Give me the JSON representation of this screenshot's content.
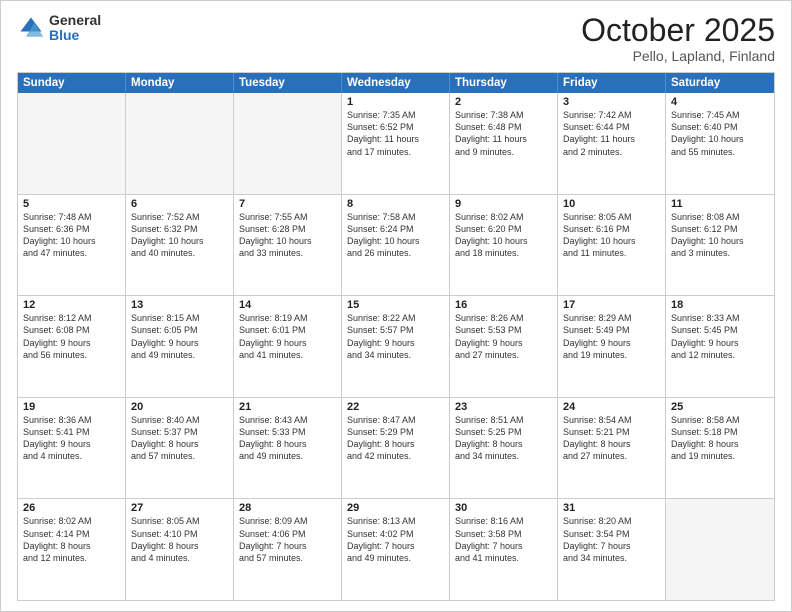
{
  "logo": {
    "general": "General",
    "blue": "Blue"
  },
  "title": {
    "month": "October 2025",
    "location": "Pello, Lapland, Finland"
  },
  "header_days": [
    "Sunday",
    "Monday",
    "Tuesday",
    "Wednesday",
    "Thursday",
    "Friday",
    "Saturday"
  ],
  "weeks": [
    [
      {
        "day": "",
        "text": ""
      },
      {
        "day": "",
        "text": ""
      },
      {
        "day": "",
        "text": ""
      },
      {
        "day": "1",
        "text": "Sunrise: 7:35 AM\nSunset: 6:52 PM\nDaylight: 11 hours\nand 17 minutes."
      },
      {
        "day": "2",
        "text": "Sunrise: 7:38 AM\nSunset: 6:48 PM\nDaylight: 11 hours\nand 9 minutes."
      },
      {
        "day": "3",
        "text": "Sunrise: 7:42 AM\nSunset: 6:44 PM\nDaylight: 11 hours\nand 2 minutes."
      },
      {
        "day": "4",
        "text": "Sunrise: 7:45 AM\nSunset: 6:40 PM\nDaylight: 10 hours\nand 55 minutes."
      }
    ],
    [
      {
        "day": "5",
        "text": "Sunrise: 7:48 AM\nSunset: 6:36 PM\nDaylight: 10 hours\nand 47 minutes."
      },
      {
        "day": "6",
        "text": "Sunrise: 7:52 AM\nSunset: 6:32 PM\nDaylight: 10 hours\nand 40 minutes."
      },
      {
        "day": "7",
        "text": "Sunrise: 7:55 AM\nSunset: 6:28 PM\nDaylight: 10 hours\nand 33 minutes."
      },
      {
        "day": "8",
        "text": "Sunrise: 7:58 AM\nSunset: 6:24 PM\nDaylight: 10 hours\nand 26 minutes."
      },
      {
        "day": "9",
        "text": "Sunrise: 8:02 AM\nSunset: 6:20 PM\nDaylight: 10 hours\nand 18 minutes."
      },
      {
        "day": "10",
        "text": "Sunrise: 8:05 AM\nSunset: 6:16 PM\nDaylight: 10 hours\nand 11 minutes."
      },
      {
        "day": "11",
        "text": "Sunrise: 8:08 AM\nSunset: 6:12 PM\nDaylight: 10 hours\nand 3 minutes."
      }
    ],
    [
      {
        "day": "12",
        "text": "Sunrise: 8:12 AM\nSunset: 6:08 PM\nDaylight: 9 hours\nand 56 minutes."
      },
      {
        "day": "13",
        "text": "Sunrise: 8:15 AM\nSunset: 6:05 PM\nDaylight: 9 hours\nand 49 minutes."
      },
      {
        "day": "14",
        "text": "Sunrise: 8:19 AM\nSunset: 6:01 PM\nDaylight: 9 hours\nand 41 minutes."
      },
      {
        "day": "15",
        "text": "Sunrise: 8:22 AM\nSunset: 5:57 PM\nDaylight: 9 hours\nand 34 minutes."
      },
      {
        "day": "16",
        "text": "Sunrise: 8:26 AM\nSunset: 5:53 PM\nDaylight: 9 hours\nand 27 minutes."
      },
      {
        "day": "17",
        "text": "Sunrise: 8:29 AM\nSunset: 5:49 PM\nDaylight: 9 hours\nand 19 minutes."
      },
      {
        "day": "18",
        "text": "Sunrise: 8:33 AM\nSunset: 5:45 PM\nDaylight: 9 hours\nand 12 minutes."
      }
    ],
    [
      {
        "day": "19",
        "text": "Sunrise: 8:36 AM\nSunset: 5:41 PM\nDaylight: 9 hours\nand 4 minutes."
      },
      {
        "day": "20",
        "text": "Sunrise: 8:40 AM\nSunset: 5:37 PM\nDaylight: 8 hours\nand 57 minutes."
      },
      {
        "day": "21",
        "text": "Sunrise: 8:43 AM\nSunset: 5:33 PM\nDaylight: 8 hours\nand 49 minutes."
      },
      {
        "day": "22",
        "text": "Sunrise: 8:47 AM\nSunset: 5:29 PM\nDaylight: 8 hours\nand 42 minutes."
      },
      {
        "day": "23",
        "text": "Sunrise: 8:51 AM\nSunset: 5:25 PM\nDaylight: 8 hours\nand 34 minutes."
      },
      {
        "day": "24",
        "text": "Sunrise: 8:54 AM\nSunset: 5:21 PM\nDaylight: 8 hours\nand 27 minutes."
      },
      {
        "day": "25",
        "text": "Sunrise: 8:58 AM\nSunset: 5:18 PM\nDaylight: 8 hours\nand 19 minutes."
      }
    ],
    [
      {
        "day": "26",
        "text": "Sunrise: 8:02 AM\nSunset: 4:14 PM\nDaylight: 8 hours\nand 12 minutes."
      },
      {
        "day": "27",
        "text": "Sunrise: 8:05 AM\nSunset: 4:10 PM\nDaylight: 8 hours\nand 4 minutes."
      },
      {
        "day": "28",
        "text": "Sunrise: 8:09 AM\nSunset: 4:06 PM\nDaylight: 7 hours\nand 57 minutes."
      },
      {
        "day": "29",
        "text": "Sunrise: 8:13 AM\nSunset: 4:02 PM\nDaylight: 7 hours\nand 49 minutes."
      },
      {
        "day": "30",
        "text": "Sunrise: 8:16 AM\nSunset: 3:58 PM\nDaylight: 7 hours\nand 41 minutes."
      },
      {
        "day": "31",
        "text": "Sunrise: 8:20 AM\nSunset: 3:54 PM\nDaylight: 7 hours\nand 34 minutes."
      },
      {
        "day": "",
        "text": ""
      }
    ]
  ]
}
